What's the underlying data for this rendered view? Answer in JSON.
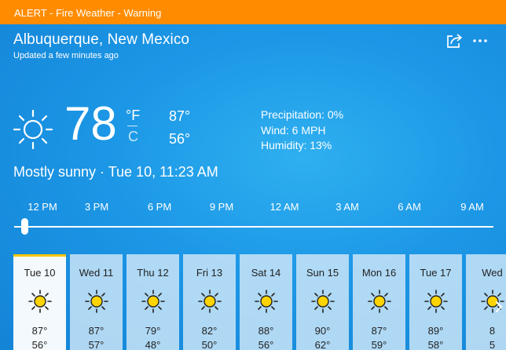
{
  "alert": {
    "text": "ALERT - Fire Weather - Warning",
    "color": "#ff8c00"
  },
  "header": {
    "location": "Albuquerque, New Mexico",
    "updated": "Updated a few minutes ago",
    "share_icon": "share-icon",
    "more_icon": "more-options-icon"
  },
  "current": {
    "icon": "sun-icon",
    "temperature": "78",
    "unit_f": "°F",
    "unit_c": "C",
    "high": "87°",
    "low": "56°",
    "precipitation": "Precipitation: 0%",
    "wind": "Wind: 6 MPH",
    "humidity": "Humidity: 13%",
    "summary": "Mostly sunny · Tue 10, 11:23 AM"
  },
  "timeline": {
    "labels": [
      "12 PM",
      "3 PM",
      "6 PM",
      "9 PM",
      "12 AM",
      "3 AM",
      "6 AM",
      "9 AM"
    ],
    "selected_index": 0
  },
  "forecast": {
    "days": [
      {
        "name": "Tue 10",
        "hi": "87°",
        "lo": "56°",
        "icon": "sun-icon"
      },
      {
        "name": "Wed 11",
        "hi": "87°",
        "lo": "57°",
        "icon": "sun-icon"
      },
      {
        "name": "Thu 12",
        "hi": "79°",
        "lo": "48°",
        "icon": "sun-icon"
      },
      {
        "name": "Fri 13",
        "hi": "82°",
        "lo": "50°",
        "icon": "sun-icon"
      },
      {
        "name": "Sat 14",
        "hi": "88°",
        "lo": "56°",
        "icon": "sun-icon"
      },
      {
        "name": "Sun 15",
        "hi": "90°",
        "lo": "62°",
        "icon": "sun-icon"
      },
      {
        "name": "Mon 16",
        "hi": "87°",
        "lo": "59°",
        "icon": "sun-icon"
      },
      {
        "name": "Tue 17",
        "hi": "89°",
        "lo": "58°",
        "icon": "sun-icon"
      },
      {
        "name": "Wed",
        "hi": "8",
        "lo": "5",
        "icon": "sun-icon"
      }
    ],
    "selected_index": 0,
    "next_icon": "chevron-right-icon"
  },
  "colors": {
    "background": "#1c97e6",
    "sun": "#ffd400",
    "selected_indicator": "#f6c800"
  }
}
